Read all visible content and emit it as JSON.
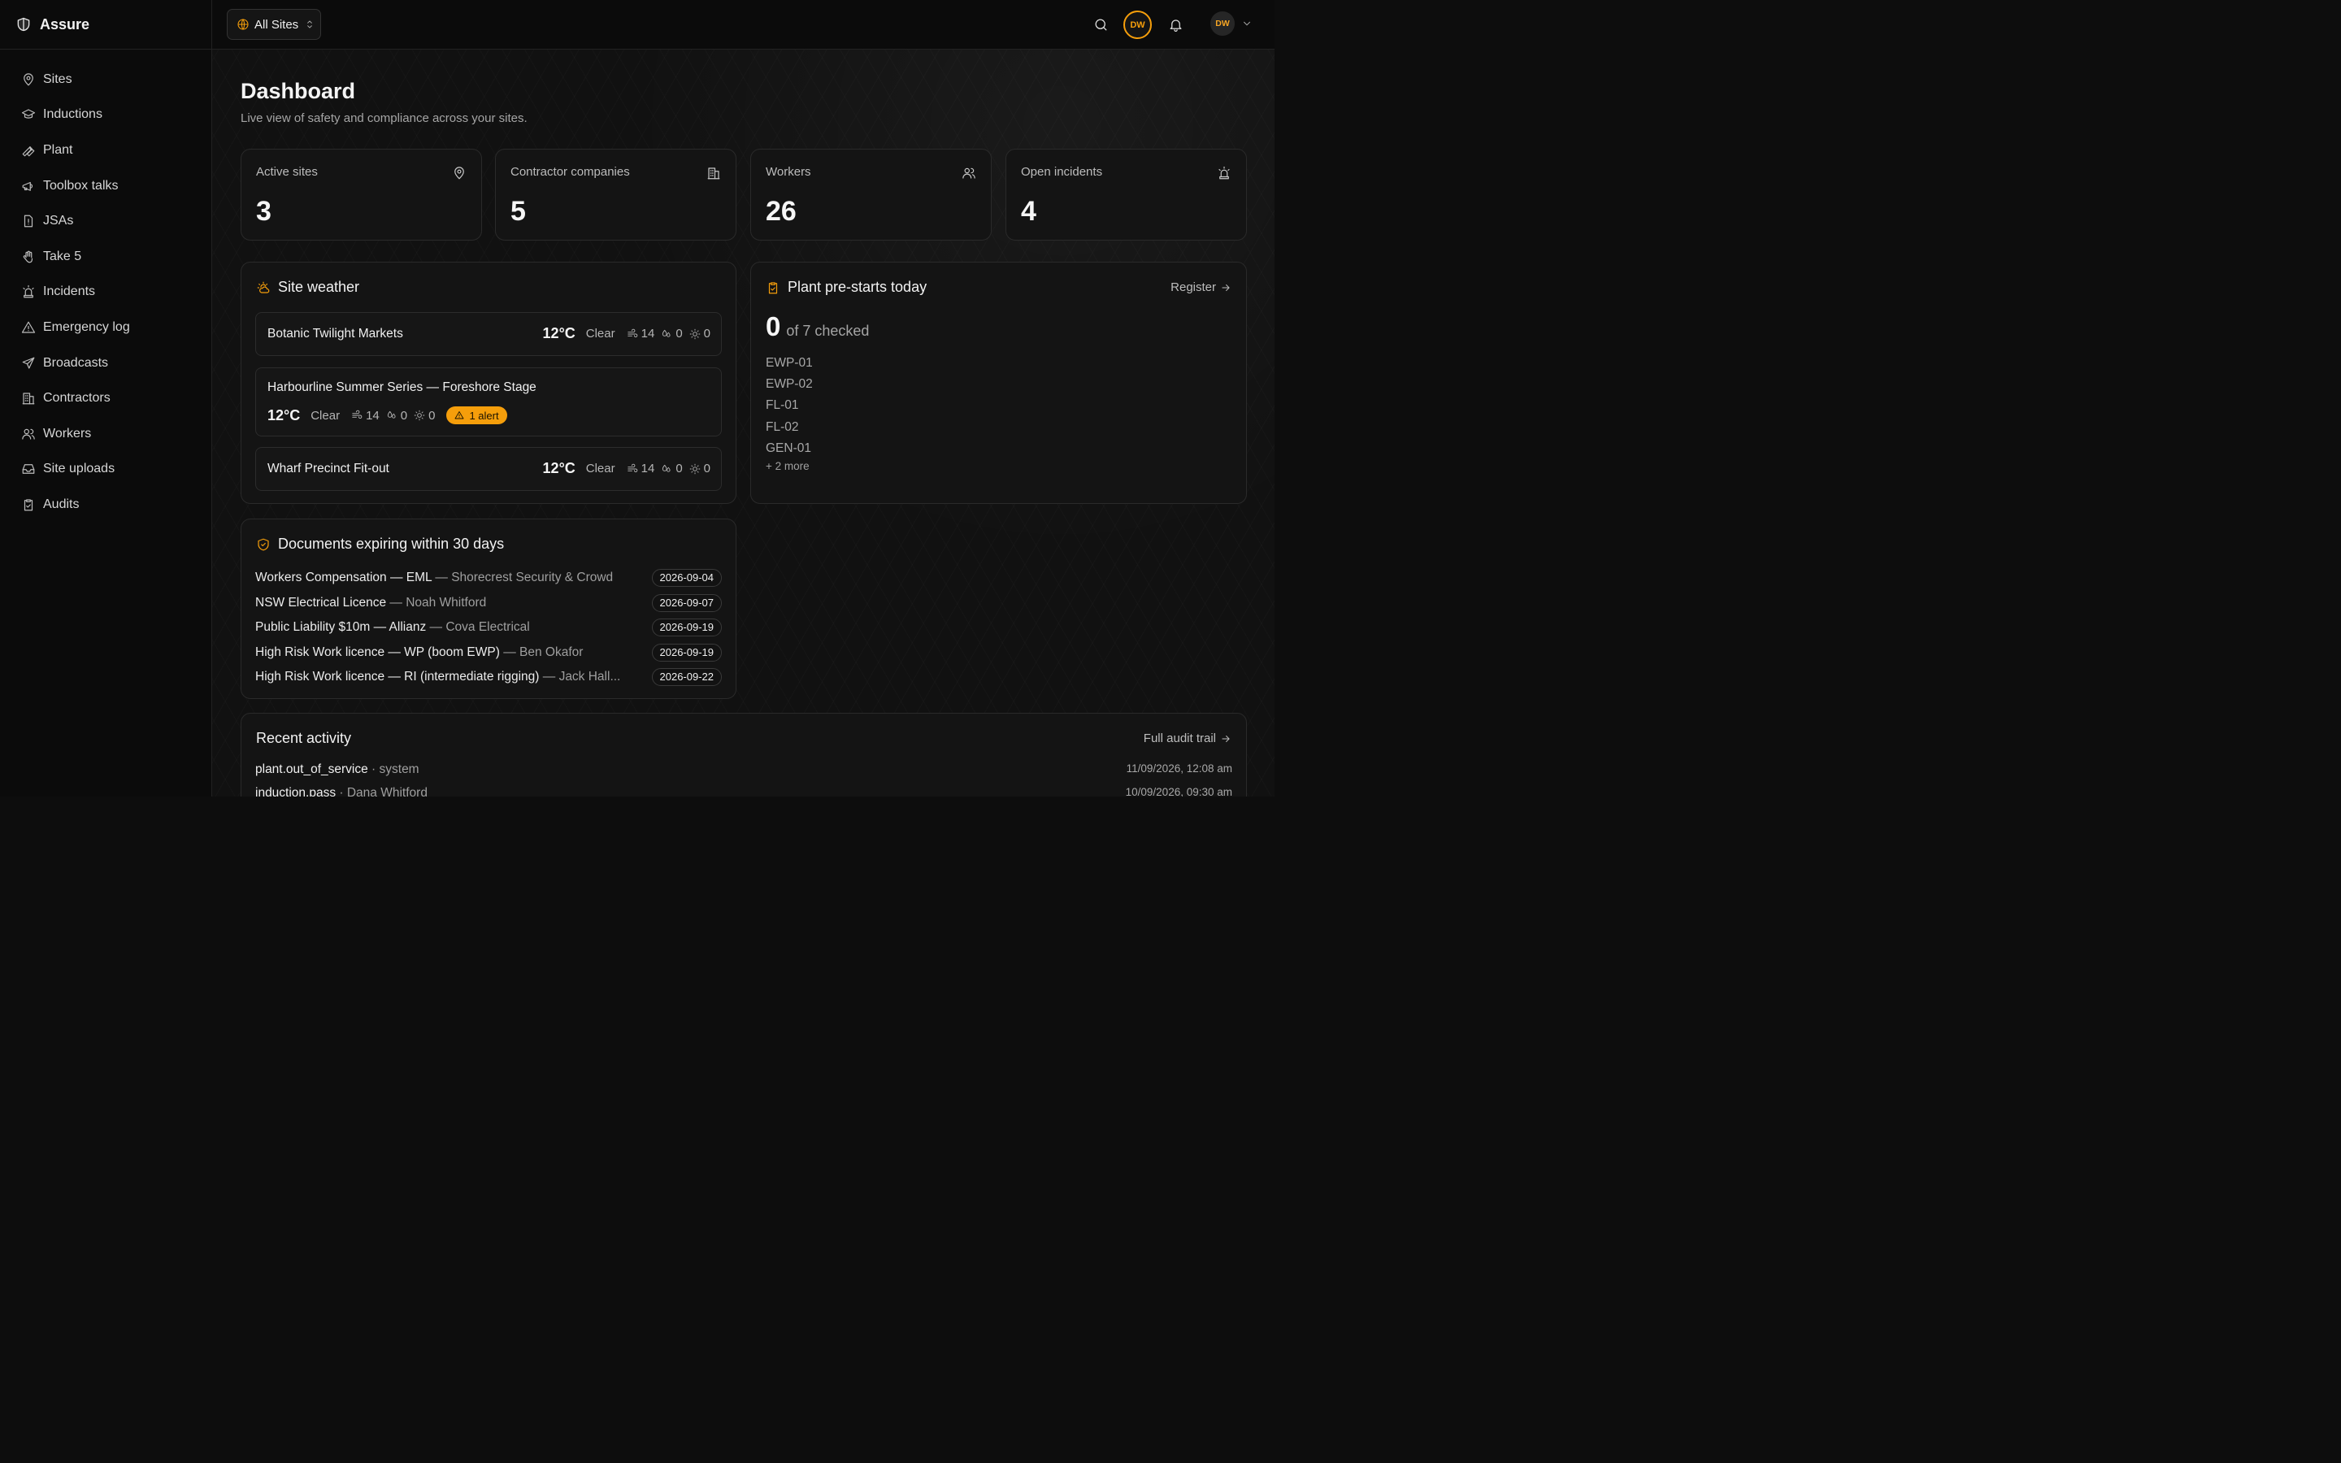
{
  "app": {
    "name": "Assure"
  },
  "sidebar": {
    "items": [
      {
        "label": "Sites",
        "icon": "map-pin-icon"
      },
      {
        "label": "Inductions",
        "icon": "graduation-cap-icon"
      },
      {
        "label": "Plant",
        "icon": "wrench-icon"
      },
      {
        "label": "Toolbox talks",
        "icon": "megaphone-icon"
      },
      {
        "label": "JSAs",
        "icon": "file-alert-icon"
      },
      {
        "label": "Take 5",
        "icon": "hand-icon"
      },
      {
        "label": "Incidents",
        "icon": "siren-icon"
      },
      {
        "label": "Emergency log",
        "icon": "triangle-alert-icon"
      },
      {
        "label": "Broadcasts",
        "icon": "send-icon"
      },
      {
        "label": "Contractors",
        "icon": "building-icon"
      },
      {
        "label": "Workers",
        "icon": "users-icon"
      },
      {
        "label": "Site uploads",
        "icon": "inbox-icon"
      },
      {
        "label": "Audits",
        "icon": "clipboard-check-icon"
      }
    ]
  },
  "topbar": {
    "site_selector": "All Sites",
    "avatar_initials": "DW",
    "user_initials": "DW"
  },
  "page": {
    "title": "Dashboard",
    "subtitle": "Live view of safety and compliance across your sites."
  },
  "stats": [
    {
      "label": "Active sites",
      "value": "3",
      "icon": "map-pin-icon"
    },
    {
      "label": "Contractor companies",
      "value": "5",
      "icon": "building-icon"
    },
    {
      "label": "Workers",
      "value": "26",
      "icon": "users-icon"
    },
    {
      "label": "Open incidents",
      "value": "4",
      "icon": "siren-icon"
    }
  ],
  "weather": {
    "title": "Site weather",
    "sites": [
      {
        "name": "Botanic Twilight Markets",
        "temp": "12°C",
        "condition": "Clear",
        "wind": "14",
        "rain": "0",
        "uv": "0",
        "alert": ""
      },
      {
        "name": "Harbourline Summer Series — Foreshore Stage",
        "temp": "12°C",
        "condition": "Clear",
        "wind": "14",
        "rain": "0",
        "uv": "0",
        "alert": "1 alert"
      },
      {
        "name": "Wharf Precinct Fit-out",
        "temp": "12°C",
        "condition": "Clear",
        "wind": "14",
        "rain": "0",
        "uv": "0",
        "alert": ""
      }
    ]
  },
  "plant": {
    "title": "Plant pre-starts today",
    "link": "Register",
    "checked": "0",
    "of_text": "of 7 checked",
    "items": [
      "EWP-01",
      "EWP-02",
      "FL-01",
      "FL-02",
      "GEN-01"
    ],
    "more": "+ 2 more"
  },
  "documents": {
    "title": "Documents expiring within 30 days",
    "items": [
      {
        "name": "Workers Compensation — EML",
        "holder": " — Shorecrest Security & Crowd",
        "date": "2026-09-04"
      },
      {
        "name": "NSW Electrical Licence",
        "holder": " — Noah Whitford",
        "date": "2026-09-07"
      },
      {
        "name": "Public Liability $10m — Allianz",
        "holder": " — Cova Electrical",
        "date": "2026-09-19"
      },
      {
        "name": "High Risk Work licence — WP (boom EWP)",
        "holder": " — Ben Okafor",
        "date": "2026-09-19"
      },
      {
        "name": "High Risk Work licence — RI (intermediate rigging)",
        "holder": " — Jack Hall...",
        "date": "2026-09-22"
      }
    ]
  },
  "activity": {
    "title": "Recent activity",
    "link": "Full audit trail",
    "items": [
      {
        "event": "plant.out_of_service",
        "actor": " · system",
        "time": "11/09/2026, 12:08 am"
      },
      {
        "event": "induction.pass",
        "actor": " · Dana Whitford",
        "time": "10/09/2026, 09:30 am"
      }
    ]
  },
  "colors": {
    "accent": "#f59e0b",
    "background": "#111111",
    "card": "#141414"
  }
}
